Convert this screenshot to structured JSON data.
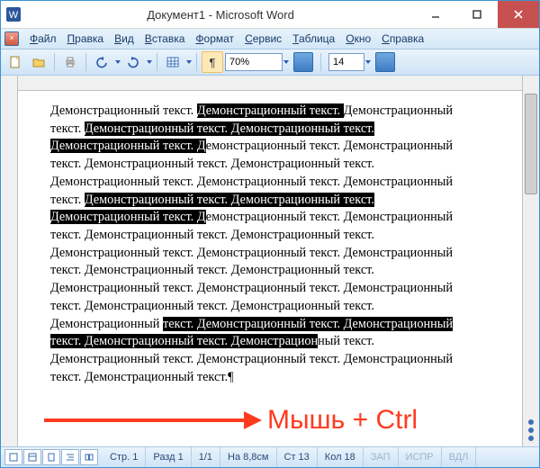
{
  "window": {
    "title": "Документ1 - Microsoft Word"
  },
  "menu": {
    "items": [
      "Файл",
      "Правка",
      "Вид",
      "Вставка",
      "Формат",
      "Сервис",
      "Таблица",
      "Окно",
      "Справка"
    ]
  },
  "toolbar": {
    "zoom": "70%",
    "font_size": "14"
  },
  "document": {
    "sentence": "Демонстрационный текст.",
    "selections_note": "multiple non-contiguous selections highlighted (Ctrl+click demo)"
  },
  "annotation": {
    "label": "Мышь + Ctrl"
  },
  "status": {
    "page": "Стр. 1",
    "section": "Разд 1",
    "pages": "1/1",
    "at": "На 8,8см",
    "line": "Ст 13",
    "col": "Кол 18",
    "flag1": "ЗАП",
    "flag2": "ИСПР",
    "flag3": "ВДЛ"
  }
}
